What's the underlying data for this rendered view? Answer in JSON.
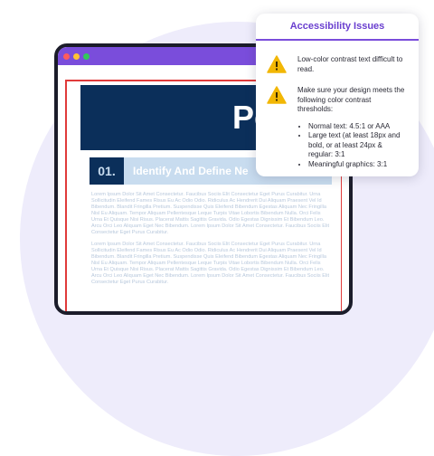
{
  "document": {
    "title": "Policy",
    "section_number": "01.",
    "section_title": "Identify And Define Ne",
    "body_paragraphs": [
      "Lorem Ipsum Dolor Sit Amet Consectetur. Faucibus Sociis Elit Consectetur Eget Purus Curabitur. Urna Sollicitudin Eleifend Fames Risus Eu Ac Odio Odio. Ridiculus Ac Hendrerit Dui Aliquam Praesent Vel Id Bibendum. Blandit Fringilla Pretium. Suspendisse Quis Eleifend Bibendum Egestas Aliquam Nec Fringilla Nisl Eu Aliquam. Tempor Aliquam Pellentesque Leque Turpis Vitae Lobortis Bibendum Nulla. Orci Felis Urna Et Quisque Nisi Risus. Placerat Mattis Sagittis Gravida. Odio Egestas Dignissim Et Bibendum Leo. Arcu Orci Leo Aliquam Eget Nec Bibendum. Lorem Ipsum Dolor Sit Amet Consectetur. Faucibus Sociis Elit Consectetur Eget Purus Curabitur.",
      "Lorem Ipsum Dolor Sit Amet Consectetur. Faucibus Sociis Elit Consectetur Eget Purus Curabitur. Urna Sollicitudin Eleifend Fames Risus Eu Ac Odio Odio. Ridiculus Ac Hendrerit Dui Aliquam Praesent Vel Id Bibendum. Blandit Fringilla Pretium. Suspendisse Quis Eleifend Bibendum Egestas Aliquam Nec Fringilla Nisl Eu Aliquam. Tempor Aliquam Pellentesque Leque Turpis Vitae Lobortis Bibendum Nulla. Orci Felis Urna Et Quisque Nisi Risus. Placerat Mattis Sagittis Gravida. Odio Egestas Dignissim Et Bibendum Leo. Arcu Orci Leo Aliquam Eget Nec Bibendum. Lorem Ipsum Dolor Sit Amet Consectetur. Faucibus Sociis Elit Consectetur Eget Purus Curabitur."
    ]
  },
  "panel": {
    "title": "Accessibility Issues",
    "issue_1": "Low-color contrast text difficult to read.",
    "issue_2": "Make sure your design meets the following color contrast thresholds:",
    "requirements": [
      "Normal text: 4.5:1 or AAA",
      "Large text (at least 18px and bold, or at least 24px & regular: 3:1",
      "Meaningful graphics:   3:1"
    ]
  },
  "icons": {
    "warning": "warning-icon"
  },
  "colors": {
    "accent": "#7a4ddb",
    "hero_bg": "#0b2f5a",
    "warning": "#f2b705",
    "error_outline": "#e03a3a"
  }
}
